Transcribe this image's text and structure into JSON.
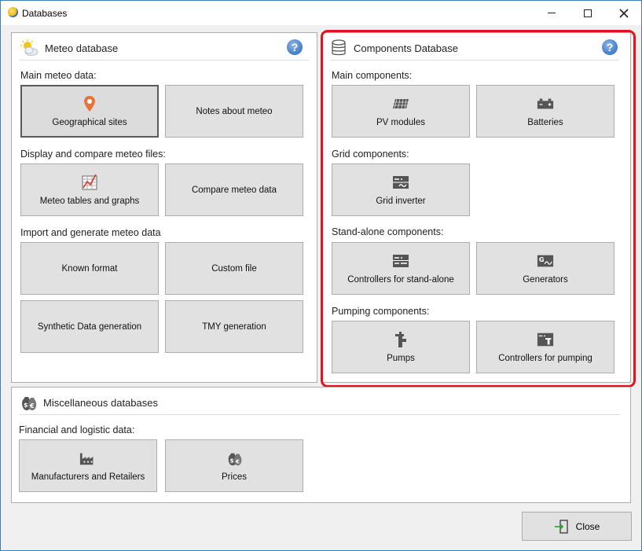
{
  "window": {
    "title": "Databases"
  },
  "meteo": {
    "title": "Meteo database",
    "main_label": "Main meteo data:",
    "geo_sites": "Geographical sites",
    "notes": "Notes about meteo",
    "display_label": "Display and compare meteo files:",
    "tables_graphs": "Meteo tables and graphs",
    "compare": "Compare meteo data",
    "import_label": "Import and generate meteo data",
    "known_format": "Known format",
    "custom_file": "Custom file",
    "synthetic": "Synthetic Data generation",
    "tmy": "TMY generation"
  },
  "components": {
    "title": "Components Database",
    "main_label": "Main components:",
    "pv_modules": "PV modules",
    "batteries": "Batteries",
    "grid_label": "Grid components:",
    "grid_inverter": "Grid inverter",
    "standalone_label": "Stand-alone components:",
    "controllers_standalone": "Controllers for stand-alone",
    "generators": "Generators",
    "pumping_label": "Pumping components:",
    "pumps": "Pumps",
    "controllers_pumping": "Controllers for pumping"
  },
  "misc": {
    "title": "Miscellaneous databases",
    "financial_label": "Financial and logistic data:",
    "manufacturers": "Manufacturers and Retailers",
    "prices": "Prices"
  },
  "footer": {
    "close": "Close"
  },
  "icons": {
    "app": "pvsyst-sun-icon",
    "help": "help-icon",
    "colors": {
      "accent_blue": "#4a84cc",
      "highlight_red": "#e0141e",
      "pin_orange": "#e8723a"
    }
  }
}
